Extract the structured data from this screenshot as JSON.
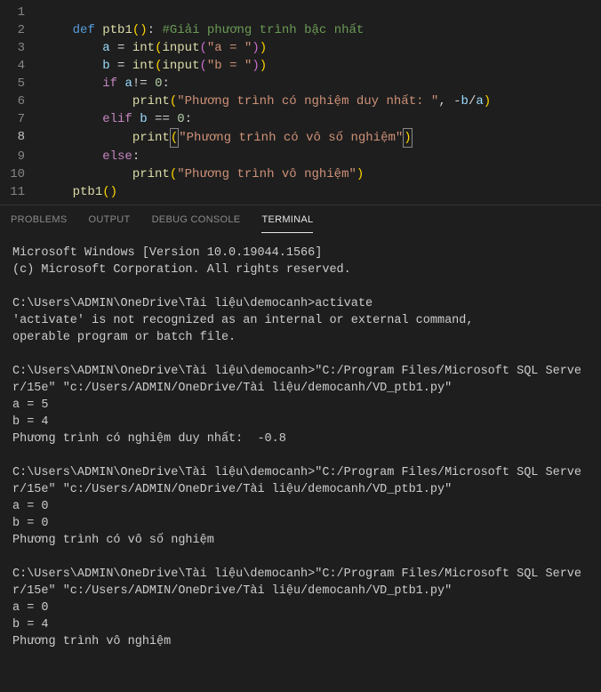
{
  "editor": {
    "lines": [
      {
        "num": "1",
        "html": ""
      },
      {
        "num": "2",
        "html": "    <span class='kw'>def</span> <span class='fn'>ptb1</span><span class='paren'>()</span><span class='op'>:</span> <span class='com'>#Giải phương trình bậc nhất</span>"
      },
      {
        "num": "3",
        "html": "        <span class='var'>a</span> <span class='op'>=</span> <span class='fn'>int</span><span class='paren'>(</span><span class='fn'>input</span><span class='paren2'>(</span><span class='str'>\"a = \"</span><span class='paren2'>)</span><span class='paren'>)</span>"
      },
      {
        "num": "4",
        "html": "        <span class='var'>b</span> <span class='op'>=</span> <span class='fn'>int</span><span class='paren'>(</span><span class='fn'>input</span><span class='paren2'>(</span><span class='str'>\"b = \"</span><span class='paren2'>)</span><span class='paren'>)</span>"
      },
      {
        "num": "5",
        "html": "        <span class='kw2'>if</span> <span class='var'>a</span><span class='op'>!=</span> <span class='num'>0</span><span class='op'>:</span>"
      },
      {
        "num": "6",
        "html": "            <span class='fn'>print</span><span class='paren'>(</span><span class='str'>\"Phương trình có nghiệm duy nhất: \"</span><span class='op'>,</span> <span class='op'>-</span><span class='var'>b</span><span class='op'>/</span><span class='var'>a</span><span class='paren'>)</span>"
      },
      {
        "num": "7",
        "html": "        <span class='kw2'>elif</span> <span class='var'>b</span> <span class='op'>==</span> <span class='num'>0</span><span class='op'>:</span>"
      },
      {
        "num": "8",
        "active": true,
        "html": "            <span class='fn'>print</span><span class='paren cursor-box'>(</span><span class='str'>\"Phương trình có vô số nghiệm\"</span><span class='paren cursor-box'>)</span>"
      },
      {
        "num": "9",
        "html": "        <span class='kw2'>else</span><span class='op'>:</span>"
      },
      {
        "num": "10",
        "html": "            <span class='fn'>print</span><span class='paren'>(</span><span class='str'>\"Phương trình vô nghiệm\"</span><span class='paren'>)</span>"
      },
      {
        "num": "11",
        "html": "    <span class='fn'>ptb1</span><span class='paren'>()</span>"
      }
    ]
  },
  "tabs": {
    "problems": "PROBLEMS",
    "output": "OUTPUT",
    "debug": "DEBUG CONSOLE",
    "terminal": "TERMINAL"
  },
  "terminal": {
    "lines": [
      "Microsoft Windows [Version 10.0.19044.1566]",
      "(c) Microsoft Corporation. All rights reserved.",
      "",
      "C:\\Users\\ADMIN\\OneDrive\\Tài liệu\\democanh>activate",
      "'activate' is not recognized as an internal or external command,",
      "operable program or batch file.",
      "",
      "C:\\Users\\ADMIN\\OneDrive\\Tài liệu\\democanh>\"C:/Program Files/Microsoft SQL Server/15e\" \"c:/Users/ADMIN/OneDrive/Tài liệu/democanh/VD_ptb1.py\"",
      "a = 5",
      "b = 4",
      "Phương trình có nghiệm duy nhất:  -0.8",
      "",
      "C:\\Users\\ADMIN\\OneDrive\\Tài liệu\\democanh>\"C:/Program Files/Microsoft SQL Server/15e\" \"c:/Users/ADMIN/OneDrive/Tài liệu/democanh/VD_ptb1.py\"",
      "a = 0",
      "b = 0",
      "Phương trình có vô số nghiệm",
      "",
      "C:\\Users\\ADMIN\\OneDrive\\Tài liệu\\democanh>\"C:/Program Files/Microsoft SQL Server/15e\" \"c:/Users/ADMIN/OneDrive/Tài liệu/democanh/VD_ptb1.py\"",
      "a = 0",
      "b = 4",
      "Phương trình vô nghiệm"
    ]
  }
}
